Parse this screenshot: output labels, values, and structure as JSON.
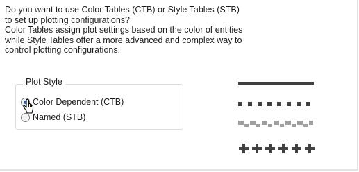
{
  "description": {
    "lines": [
      "Do you want to use Color Tables (CTB) or Style Tables (STB)",
      "to set up plotting configurations?",
      "Color Tables assign plot settings based on the color of entities",
      "while Style Tables offer a more advanced and complex way to",
      "control plotting configurations."
    ]
  },
  "plot_style": {
    "title": "Plot Style",
    "options": [
      {
        "label": "Color Dependent (CTB)",
        "selected": true
      },
      {
        "label": "Named (STB)",
        "selected": false
      }
    ]
  },
  "preview": {
    "samples": [
      "solid-line-icon",
      "dashed-line-icon",
      "dotted-pattern-line-icon",
      "plus-pattern-line-icon"
    ],
    "line_color": "#404040"
  },
  "colors": {
    "accent": "#1e5fb4",
    "group_border": "#d5dfe5",
    "text": "#1e1e1e"
  }
}
